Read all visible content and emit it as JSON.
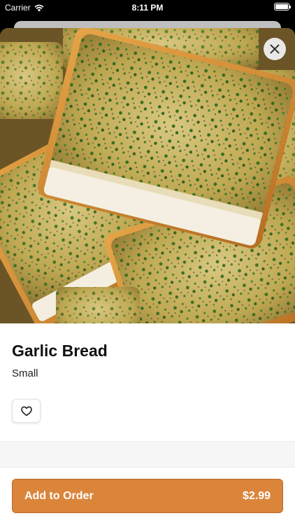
{
  "status_bar": {
    "carrier": "Carrier",
    "time": "8:11 PM"
  },
  "product": {
    "name": "Garlic Bread",
    "size": "Small",
    "image_icon": "garlic-bread-photo"
  },
  "actions": {
    "close_icon": "close-icon",
    "favorite_icon": "heart-outline-icon",
    "add_label": "Add to Order",
    "price": "$2.99"
  },
  "colors": {
    "accent": "#db853b",
    "accent_border": "#b9672a",
    "text_primary": "#111111"
  }
}
